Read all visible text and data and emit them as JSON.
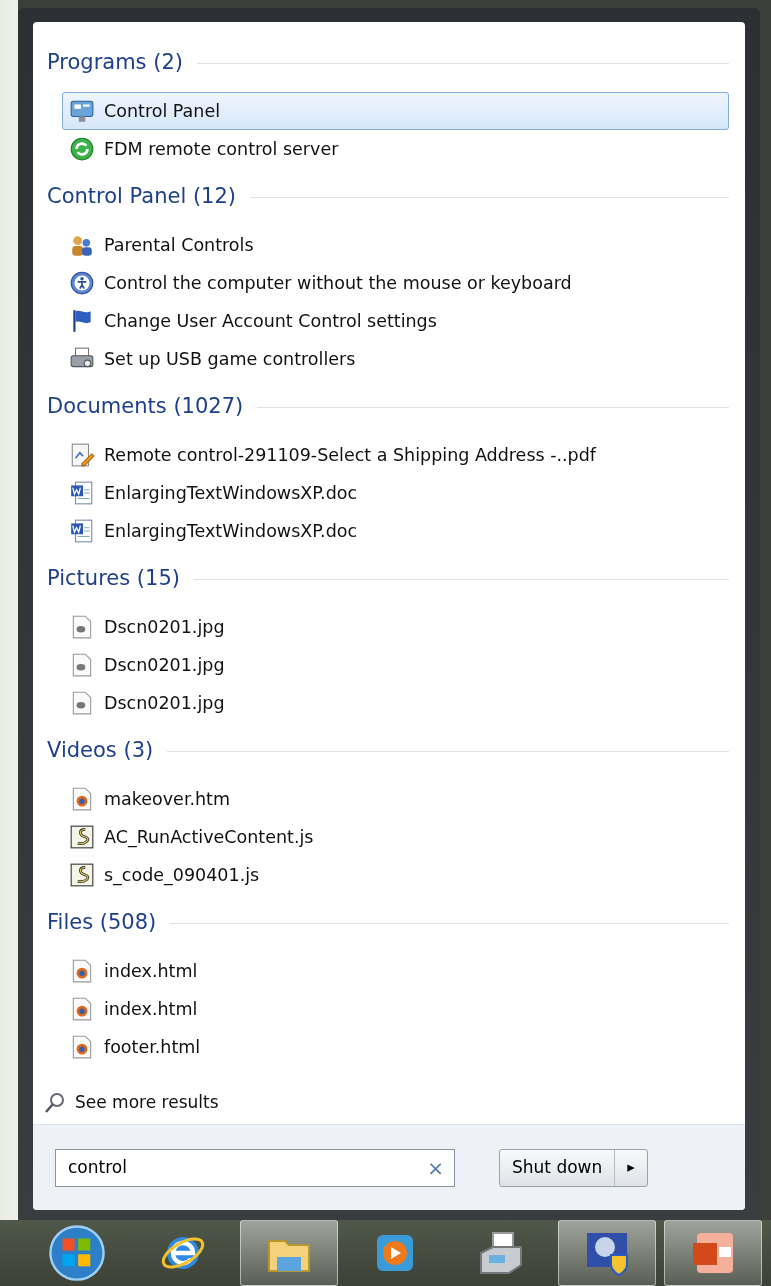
{
  "sections": [
    {
      "title": "Programs (2)",
      "items": [
        {
          "label": "Control Panel",
          "kind": "control-panel",
          "selected": true
        },
        {
          "label": "FDM remote control server",
          "kind": "fdm",
          "selected": false
        }
      ]
    },
    {
      "title": "Control Panel (12)",
      "items": [
        {
          "label": "Parental Controls",
          "kind": "parental",
          "selected": false
        },
        {
          "label": "Control the computer without the mouse or keyboard",
          "kind": "ease",
          "selected": false
        },
        {
          "label": "Change User Account Control settings",
          "kind": "flag",
          "selected": false
        },
        {
          "label": "Set up USB game controllers",
          "kind": "printer",
          "selected": false
        }
      ]
    },
    {
      "title": "Documents (1027)",
      "items": [
        {
          "label": "Remote control-291109-Select a Shipping Address -..pdf",
          "kind": "pdf",
          "selected": false
        },
        {
          "label": "EnlargingTextWindowsXP.doc",
          "kind": "word",
          "selected": false
        },
        {
          "label": "EnlargingTextWindowsXP.doc",
          "kind": "word",
          "selected": false
        }
      ]
    },
    {
      "title": "Pictures (15)",
      "items": [
        {
          "label": "Dscn0201.jpg",
          "kind": "image",
          "selected": false
        },
        {
          "label": "Dscn0201.jpg",
          "kind": "image",
          "selected": false
        },
        {
          "label": "Dscn0201.jpg",
          "kind": "image",
          "selected": false
        }
      ]
    },
    {
      "title": "Videos (3)",
      "items": [
        {
          "label": "makeover.htm",
          "kind": "web",
          "selected": false
        },
        {
          "label": "AC_RunActiveContent.js",
          "kind": "script",
          "selected": false
        },
        {
          "label": "s_code_090401.js",
          "kind": "script",
          "selected": false
        }
      ]
    },
    {
      "title": "Files (508)",
      "items": [
        {
          "label": "index.html",
          "kind": "web",
          "selected": false
        },
        {
          "label": "index.html",
          "kind": "web",
          "selected": false
        },
        {
          "label": "footer.html",
          "kind": "web",
          "selected": false
        }
      ]
    }
  ],
  "see_more": "See more results",
  "search": {
    "value": "control",
    "clear": "×"
  },
  "shutdown": {
    "label": "Shut down",
    "arrow": "▸"
  },
  "taskbar": [
    {
      "kind": "start",
      "running": false
    },
    {
      "kind": "browser",
      "running": false
    },
    {
      "kind": "folder",
      "running": true
    },
    {
      "kind": "media",
      "running": false
    },
    {
      "kind": "fax",
      "running": false
    },
    {
      "kind": "security",
      "running": true
    },
    {
      "kind": "slides",
      "running": true
    }
  ]
}
